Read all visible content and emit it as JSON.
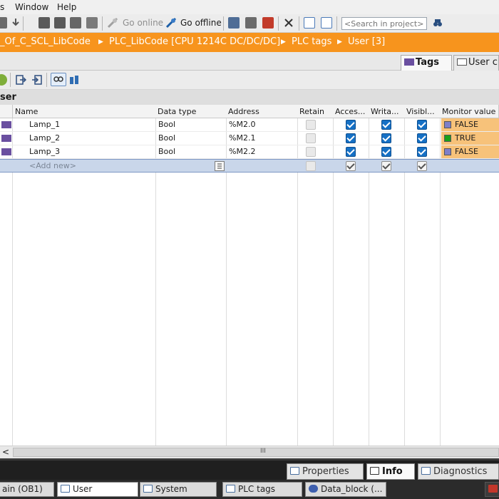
{
  "menu": {
    "items": [
      "s",
      "Window",
      "Help"
    ]
  },
  "toolbar": {
    "go_online": "Go online",
    "go_offline": "Go offline",
    "search_placeholder": "<Search in project>"
  },
  "breadcrumb": {
    "items": [
      "_Of_C_SCL_LibCode",
      "PLC_LibCode [CPU 1214C DC/DC/DC]",
      "PLC tags",
      "User [3]"
    ],
    "separator": "▶"
  },
  "tabs": [
    {
      "label": "Tags",
      "active": true
    },
    {
      "label": "User c",
      "active": false
    }
  ],
  "table": {
    "title": "ser",
    "columns": [
      "Name",
      "Data type",
      "Address",
      "Retain",
      "Acces...",
      "Writa...",
      "Visibl...",
      "Monitor value"
    ],
    "rows": [
      {
        "name": "Lamp_1",
        "type": "Bool",
        "address": "%M2.0",
        "retain": false,
        "accessible": true,
        "writable": true,
        "visible": true,
        "monitor": "FALSE",
        "monitor_color": "#7f7fc8"
      },
      {
        "name": "Lamp_2",
        "type": "Bool",
        "address": "%M2.1",
        "retain": false,
        "accessible": true,
        "writable": true,
        "visible": true,
        "monitor": "TRUE",
        "monitor_color": "#1aa01a"
      },
      {
        "name": "Lamp_3",
        "type": "Bool",
        "address": "%M2.2",
        "retain": false,
        "accessible": true,
        "writable": true,
        "visible": true,
        "monitor": "FALSE",
        "monitor_color": "#7f7fc8"
      }
    ],
    "add_new": "<Add new>"
  },
  "scrollbar": {
    "left_arrow": "<",
    "grip": "III"
  },
  "inspector_tabs": [
    {
      "label": "Properties",
      "active": false
    },
    {
      "label": "Info",
      "active": true
    },
    {
      "label": "Diagnostics",
      "active": false
    }
  ],
  "editor_tabs": [
    {
      "label": "ain (OB1)",
      "active": false
    },
    {
      "label": "User",
      "active": true
    },
    {
      "label": "System",
      "active": false
    },
    {
      "label": "PLC tags",
      "active": false
    },
    {
      "label": "Data_block (...",
      "active": false
    }
  ],
  "colors": {
    "accent_orange": "#f7941d",
    "checkbox_blue": "#1570c5",
    "monitor_bg": "#f7c27a"
  }
}
